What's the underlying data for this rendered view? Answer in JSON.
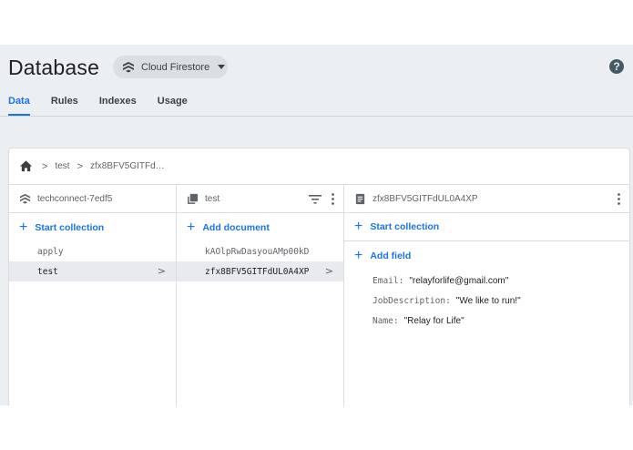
{
  "header": {
    "title": "Database",
    "product_label": "Cloud Firestore",
    "help_icon": "help-icon"
  },
  "tabs": [
    {
      "label": "Data",
      "active": true
    },
    {
      "label": "Rules",
      "active": false
    },
    {
      "label": "Indexes",
      "active": false
    },
    {
      "label": "Usage",
      "active": false
    }
  ],
  "breadcrumb": {
    "items": [
      "test",
      "zfx8BFV5GITFd…"
    ]
  },
  "columns": {
    "root": {
      "title": "techconnect-7edf5",
      "add_label": "Start collection",
      "items": [
        {
          "label": "apply",
          "selected": false
        },
        {
          "label": "test",
          "selected": true
        }
      ]
    },
    "collection": {
      "title": "test",
      "add_label": "Add document",
      "items": [
        {
          "label": "kAOlpRwDasyouAMp00kD",
          "selected": false
        },
        {
          "label": "zfx8BFV5GITFdUL0A4XP",
          "selected": true
        }
      ]
    },
    "document": {
      "title": "zfx8BFV5GITFdUL0A4XP",
      "add_collection_label": "Start collection",
      "add_field_label": "Add field",
      "fields": [
        {
          "key": "Email:",
          "value": "\"relayforlife@gmail.com\""
        },
        {
          "key": "JobDescription:",
          "value": "\"We like to run!\""
        },
        {
          "key": "Name:",
          "value": "\"Relay for Life\""
        }
      ]
    }
  },
  "colors": {
    "accent": "#1a73e8",
    "background": "#eceff1",
    "selected_row": "#e8eaed"
  }
}
